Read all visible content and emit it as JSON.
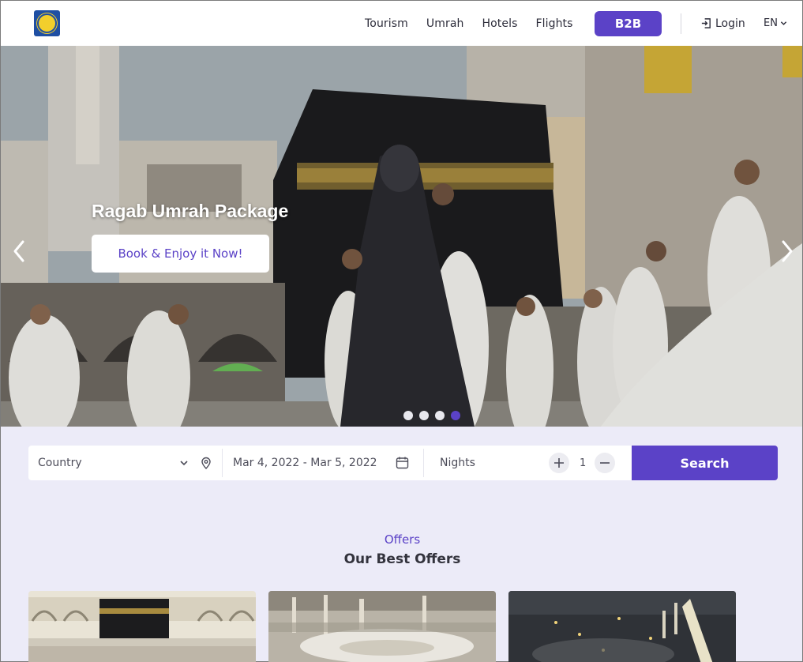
{
  "brand": {
    "logo_icon": "company-seal-logo"
  },
  "nav": {
    "links": [
      "Tourism",
      "Umrah",
      "Hotels",
      "Flights"
    ],
    "b2b_label": "B2B",
    "login_label": "Login",
    "language": "EN"
  },
  "hero": {
    "title": "Ragab Umrah Package",
    "cta_label": "Book & Enjoy it Now!",
    "slide_count": 4,
    "active_slide": 4
  },
  "search": {
    "country_placeholder": "Country",
    "date_range": "Mar 4, 2022 - Mar 5, 2022",
    "nights_label": "Nights",
    "nights_value": "1",
    "search_label": "Search"
  },
  "offers": {
    "kicker": "Offers",
    "title": "Our Best Offers"
  },
  "colors": {
    "accent": "#5b42c7",
    "background": "#ecebf8",
    "navbar": "#ffffff"
  }
}
